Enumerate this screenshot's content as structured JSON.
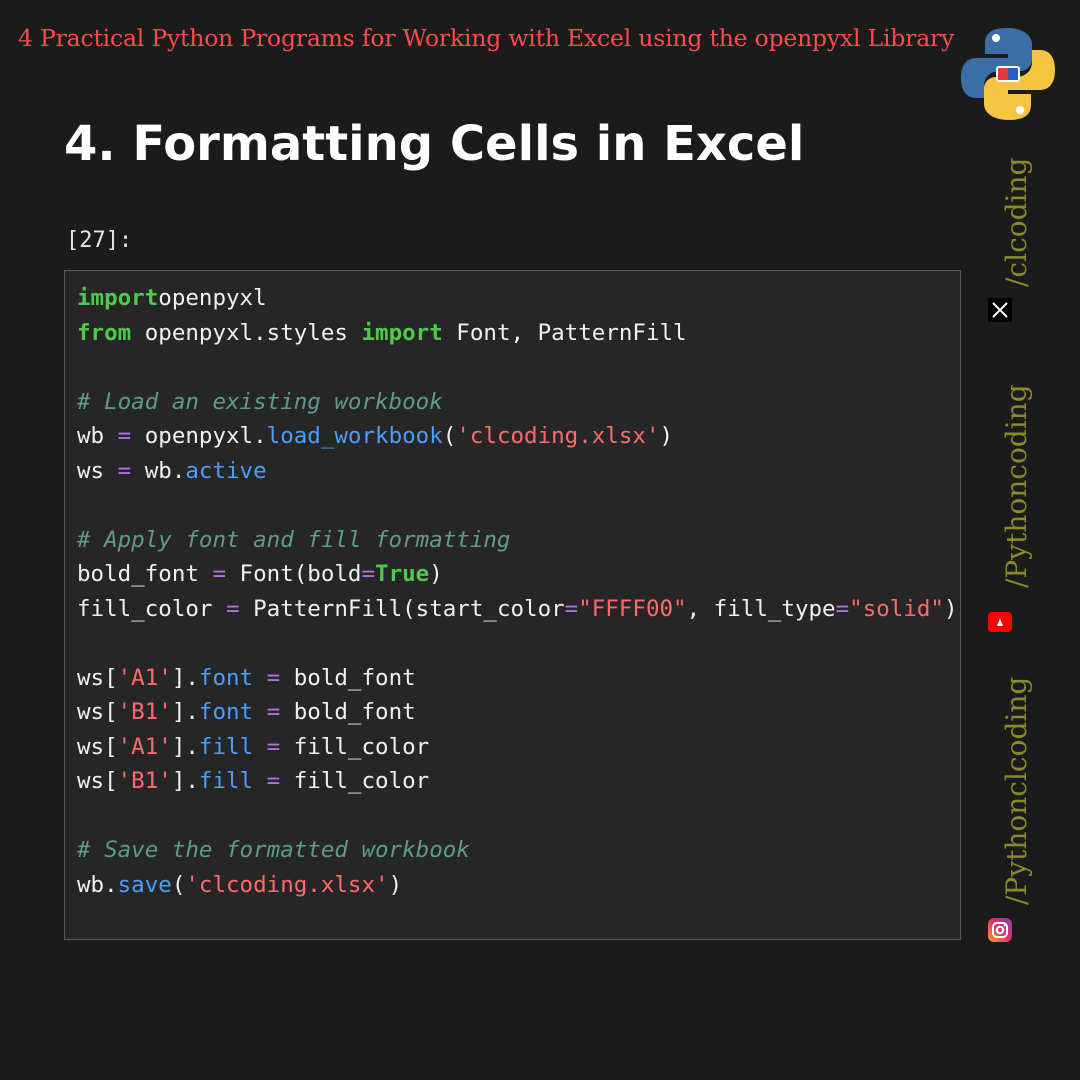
{
  "header": {
    "title": "4 Practical Python Programs for Working with Excel using the openpyxl Library"
  },
  "section": {
    "heading": "4. Formatting Cells in Excel",
    "cell_prompt": "[27]:"
  },
  "code_lines": [
    [
      [
        "kw",
        "import"
      ],
      [
        "",
        "openpyxl"
      ]
    ],
    [
      [
        "kw",
        "from"
      ],
      [
        "",
        " openpyxl.styles "
      ],
      [
        "kw",
        "import"
      ],
      [
        "",
        " Font, PatternFill"
      ]
    ],
    [],
    [
      [
        "cm",
        "# Load an existing workbook"
      ]
    ],
    [
      [
        "",
        "wb "
      ],
      [
        "op",
        "="
      ],
      [
        "",
        " openpyxl."
      ],
      [
        "at",
        "load_workbook"
      ],
      [
        "",
        "("
      ],
      [
        "st",
        "'clcoding.xlsx'"
      ],
      [
        "",
        ")"
      ]
    ],
    [
      [
        "",
        "ws "
      ],
      [
        "op",
        "="
      ],
      [
        "",
        " wb."
      ],
      [
        "at",
        "active"
      ]
    ],
    [],
    [
      [
        "cm",
        "# Apply font and fill formatting"
      ]
    ],
    [
      [
        "",
        "bold_font "
      ],
      [
        "op",
        "="
      ],
      [
        "",
        " Font(bold"
      ],
      [
        "op",
        "="
      ],
      [
        "tr",
        "True"
      ],
      [
        "",
        ")"
      ]
    ],
    [
      [
        "",
        "fill_color "
      ],
      [
        "op",
        "="
      ],
      [
        "",
        " PatternFill(start_color"
      ],
      [
        "op",
        "="
      ],
      [
        "st",
        "\"FFFF00\""
      ],
      [
        "",
        ", fill_type"
      ],
      [
        "op",
        "="
      ],
      [
        "st",
        "\"solid\""
      ],
      [
        "",
        ")"
      ]
    ],
    [],
    [
      [
        "",
        "ws["
      ],
      [
        "st",
        "'A1'"
      ],
      [
        "",
        "]."
      ],
      [
        "at",
        "font"
      ],
      [
        "",
        " "
      ],
      [
        "op",
        "="
      ],
      [
        "",
        " bold_font"
      ]
    ],
    [
      [
        "",
        "ws["
      ],
      [
        "st",
        "'B1'"
      ],
      [
        "",
        "]."
      ],
      [
        "at",
        "font"
      ],
      [
        "",
        " "
      ],
      [
        "op",
        "="
      ],
      [
        "",
        " bold_font"
      ]
    ],
    [
      [
        "",
        "ws["
      ],
      [
        "st",
        "'A1'"
      ],
      [
        "",
        "]."
      ],
      [
        "at",
        "fill"
      ],
      [
        "",
        " "
      ],
      [
        "op",
        "="
      ],
      [
        "",
        " fill_color"
      ]
    ],
    [
      [
        "",
        "ws["
      ],
      [
        "st",
        "'B1'"
      ],
      [
        "",
        "]."
      ],
      [
        "at",
        "fill"
      ],
      [
        "",
        " "
      ],
      [
        "op",
        "="
      ],
      [
        "",
        " fill_color"
      ]
    ],
    [],
    [
      [
        "cm",
        "# Save the formatted workbook"
      ]
    ],
    [
      [
        "",
        "wb."
      ],
      [
        "at",
        "save"
      ],
      [
        "",
        "("
      ],
      [
        "st",
        "'clcoding.xlsx'"
      ],
      [
        "",
        ")"
      ]
    ]
  ],
  "sidebar": {
    "handles": [
      "/clcoding",
      "/Pythoncoding",
      "/Pythonclcoding"
    ],
    "icons": [
      "x-icon",
      "youtube-icon",
      "instagram-icon"
    ]
  },
  "colors": {
    "title": "#ff4b4b",
    "keyword": "#4ec94e",
    "comment": "#5f9a8f",
    "string": "#ff6b6b",
    "attribute": "#4b9eff",
    "operator": "#b56ee8",
    "handle": "#8a8a2a"
  }
}
